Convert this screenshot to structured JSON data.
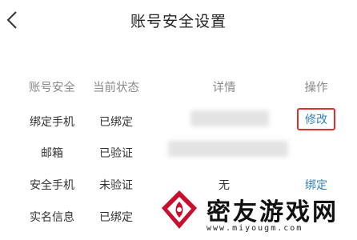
{
  "header": {
    "title": "账号安全设置",
    "back_icon": "chevron-left-icon"
  },
  "table": {
    "columns": [
      "账号安全",
      "当前状态",
      "详情",
      "操作"
    ],
    "rows": [
      {
        "name": "绑定手机",
        "status": "已绑定",
        "detail": "",
        "action": "修改"
      },
      {
        "name": "邮箱",
        "status": "已验证",
        "detail": "",
        "action": ""
      },
      {
        "name": "安全手机",
        "status": "未验证",
        "detail": "无",
        "action": "绑定"
      },
      {
        "name": "实名信息",
        "status": "已绑定",
        "detail": "",
        "action": ""
      }
    ]
  },
  "watermark": {
    "text": "密友游戏网",
    "url": "www.miyougm.com"
  },
  "colors": {
    "link": "#2f7fc1",
    "highlight_border": "#e0302a",
    "header_text": "#8a8a8a"
  }
}
